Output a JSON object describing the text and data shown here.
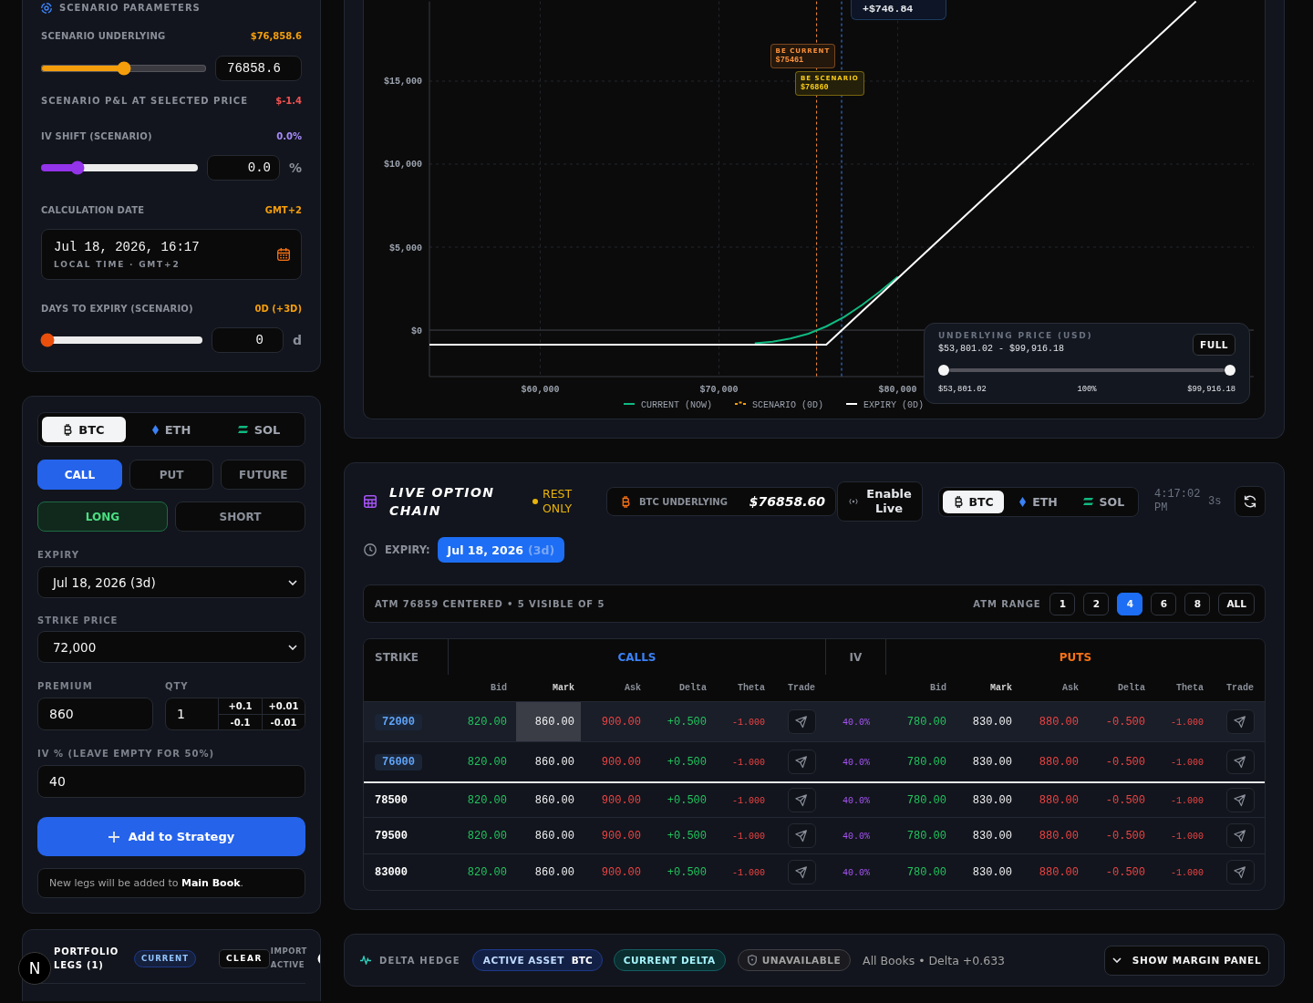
{
  "scenario_panel": {
    "title": "SCENARIO PARAMETERS",
    "underlying": {
      "label": "SCENARIO UNDERLYING",
      "value": "$76,858.6",
      "level": 0.5,
      "input": "76858.6"
    },
    "pnl": {
      "label": "SCENARIO P&L AT SELECTED PRICE",
      "value": "$-1.4"
    },
    "iv_shift": {
      "label": "IV SHIFT (SCENARIO)",
      "value": "0.0%",
      "level": 0.21,
      "input": "0.0",
      "unit": "%"
    },
    "calculation_date": {
      "label": "CALCULATION DATE",
      "value": "GMT+2",
      "date": "Jul 18, 2026, 16:17",
      "note": "LOCAL TIME · GMT+2"
    },
    "days_to_expiry": {
      "label": "DAYS TO EXPIRY (SCENARIO)",
      "value": "0D (+3D)",
      "level": 0,
      "input": "0",
      "unit": "d"
    }
  },
  "payoff_chart": {
    "chart_data": {
      "type": "line",
      "x": [
        53801.02,
        60000,
        65000,
        68000,
        70000,
        71000,
        72000,
        73000,
        74000,
        75000,
        76000,
        77000,
        78000,
        79000,
        80000,
        82000,
        85000,
        90000,
        95000,
        96680
      ],
      "series": [
        {
          "name": "CURRENT (NOW)",
          "color": "#10b981",
          "line_style": "solid",
          "values": [
            null,
            null,
            null,
            null,
            null,
            null,
            -800,
            -700,
            -510,
            -220,
            220,
            790,
            1510,
            2320,
            3220,
            null,
            null,
            null,
            null,
            null
          ]
        },
        {
          "name": "SCENARIO (0D)",
          "color": "#f59e0b",
          "line_style": "dashed",
          "values": [
            null,
            null,
            null,
            null,
            null,
            null,
            null,
            null,
            null,
            null,
            null,
            null,
            null,
            null,
            null,
            null,
            null,
            null,
            null,
            null
          ]
        },
        {
          "name": "EXPIRY (0D)",
          "color": "#ffffff",
          "line_style": "solid",
          "values": [
            -880,
            -880,
            -880,
            -880,
            -880,
            -880,
            -880,
            -880,
            -880,
            -880,
            -880,
            120,
            1120,
            2120,
            3120,
            5120,
            8120,
            13120,
            18120,
            19800
          ]
        }
      ],
      "xlim": [
        53801.02,
        99916.18
      ],
      "ylim": [
        -2800,
        19800
      ],
      "xticks": [
        {
          "value": 60000,
          "label": "$60,000"
        },
        {
          "value": 70000,
          "label": "$70,000"
        },
        {
          "value": 80000,
          "label": "$80,000"
        }
      ],
      "yticks": [
        {
          "value": 0,
          "label": "$0"
        },
        {
          "value": 5000,
          "label": "$5,000"
        },
        {
          "value": 10000,
          "label": "$10,000"
        },
        {
          "value": 15000,
          "label": "$15,000"
        }
      ],
      "grid": true,
      "legend": "bottom",
      "ref_lines": [
        {
          "axis": "x",
          "value": 75461,
          "color": "#fb923c"
        },
        {
          "axis": "x",
          "value": 76858.6,
          "color": "#3b82f6"
        }
      ],
      "annotations": [
        "+$746.84",
        "BE CURRENT",
        "$75461",
        "BE SCENARIO",
        "$76860"
      ]
    },
    "range": {
      "title": "UNDERLYING PRICE (USD)",
      "span": "$53,801.02 - $99,916.18",
      "button": "FULL",
      "handles": [
        {
          "level": 0
        },
        {
          "level": 1
        }
      ],
      "low": "$53,801.02",
      "zoom": "100%",
      "high": "$99,916.18"
    }
  },
  "order_panel": {
    "assets": [
      {
        "label": "BTC",
        "selected": true
      },
      {
        "label": "ETH",
        "selected": false
      },
      {
        "label": "SOL",
        "selected": false
      }
    ],
    "types": [
      {
        "label": "CALL",
        "selected": true
      },
      {
        "label": "PUT",
        "selected": false
      },
      {
        "label": "FUTURE",
        "selected": false
      }
    ],
    "sides": [
      {
        "label": "LONG",
        "selected": true
      },
      {
        "label": "SHORT",
        "selected": false
      }
    ],
    "expiry": {
      "label": "EXPIRY",
      "value": "Jul 18, 2026 (3d)"
    },
    "strike": {
      "label": "STRIKE PRICE",
      "value": "72,000"
    },
    "premium": {
      "label": "PREMIUM",
      "value": "860"
    },
    "qty": {
      "label": "QTY",
      "value": "1",
      "steps": [
        "+0.1",
        "+0.01",
        "-0.1",
        "-0.01"
      ]
    },
    "iv": {
      "label": "IV % (LEAVE EMPTY FOR 50%)",
      "value": "40"
    },
    "add_button": "Add to Strategy",
    "note": "New legs will be added to **Main Book**."
  },
  "option_chain": {
    "title": "LIVE OPTION CHAIN",
    "status": "REST ONLY",
    "underlying": {
      "label": "BTC UNDERLYING",
      "value": "$76858.60"
    },
    "live_button": "Enable Live",
    "assets": [
      {
        "label": "BTC",
        "selected": true
      },
      {
        "label": "ETH",
        "selected": false
      },
      {
        "label": "SOL",
        "selected": false
      }
    ],
    "time": "4:17:02 PM",
    "interval": "3s",
    "expiry": {
      "label": "EXPIRY:",
      "date": "Jul 18, 2026",
      "days": "(3d)"
    },
    "atm_summary": "ATM 76859 CENTERED • 5 VISIBLE OF 5",
    "atm_range": {
      "label": "ATM RANGE",
      "options": [
        {
          "label": "1",
          "selected": false
        },
        {
          "label": "2",
          "selected": false
        },
        {
          "label": "4",
          "selected": true
        },
        {
          "label": "6",
          "selected": false
        },
        {
          "label": "8",
          "selected": false
        },
        {
          "label": "ALL",
          "selected": false
        }
      ]
    },
    "table": {
      "strike_header": "STRIKE",
      "calls_header": "CALLS",
      "iv_header": "IV",
      "puts_header": "PUTS",
      "call_columns": [
        "Bid",
        "Mark",
        "Ask",
        "Delta",
        "Theta",
        "Trade"
      ],
      "put_columns": [
        "Bid",
        "Mark",
        "Ask",
        "Delta",
        "Theta",
        "Trade"
      ],
      "rows": [
        {
          "strike": "72000",
          "itm": true,
          "selected": true,
          "calls": {
            "bid": "820.00",
            "mark": "860.00",
            "ask": "900.00",
            "delta": "+0.500",
            "theta": "-1.000"
          },
          "iv": "40.0%",
          "puts": {
            "bid": "780.00",
            "mark": "830.00",
            "ask": "880.00",
            "delta": "-0.500",
            "theta": "-1.000"
          }
        },
        {
          "strike": "76000",
          "itm": true,
          "selected": false,
          "calls": {
            "bid": "820.00",
            "mark": "860.00",
            "ask": "900.00",
            "delta": "+0.500",
            "theta": "-1.000"
          },
          "iv": "40.0%",
          "puts": {
            "bid": "780.00",
            "mark": "830.00",
            "ask": "880.00",
            "delta": "-0.500",
            "theta": "-1.000"
          }
        },
        {
          "strike": "78500",
          "itm": false,
          "selected": false,
          "calls": {
            "bid": "820.00",
            "mark": "860.00",
            "ask": "900.00",
            "delta": "+0.500",
            "theta": "-1.000"
          },
          "iv": "40.0%",
          "puts": {
            "bid": "780.00",
            "mark": "830.00",
            "ask": "880.00",
            "delta": "-0.500",
            "theta": "-1.000"
          }
        },
        {
          "strike": "79500",
          "itm": false,
          "selected": false,
          "calls": {
            "bid": "820.00",
            "mark": "860.00",
            "ask": "900.00",
            "delta": "+0.500",
            "theta": "-1.000"
          },
          "iv": "40.0%",
          "puts": {
            "bid": "780.00",
            "mark": "830.00",
            "ask": "880.00",
            "delta": "-0.500",
            "theta": "-1.000"
          }
        },
        {
          "strike": "83000",
          "itm": false,
          "selected": false,
          "calls": {
            "bid": "820.00",
            "mark": "860.00",
            "ask": "900.00",
            "delta": "+0.500",
            "theta": "-1.000"
          },
          "iv": "40.0%",
          "puts": {
            "bid": "780.00",
            "mark": "830.00",
            "ask": "880.00",
            "delta": "-0.500",
            "theta": "-1.000"
          }
        }
      ]
    }
  },
  "portfolio": {
    "title": "PORTFOLIO LEGS (1)",
    "book": "CURRENT",
    "clear_button": "CLEAR",
    "import_label": "IMPORT ACTIVE"
  },
  "delta_hedge": {
    "title": "DELTA HEDGE",
    "active_asset": {
      "label": "ACTIVE ASSET",
      "value": "BTC"
    },
    "current_delta": "CURRENT DELTA",
    "status": "UNAVAILABLE",
    "summary": "All Books • Delta +0.633",
    "margin_button": "SHOW MARGIN PANEL"
  },
  "dev_badge": {
    "letter": "N"
  }
}
